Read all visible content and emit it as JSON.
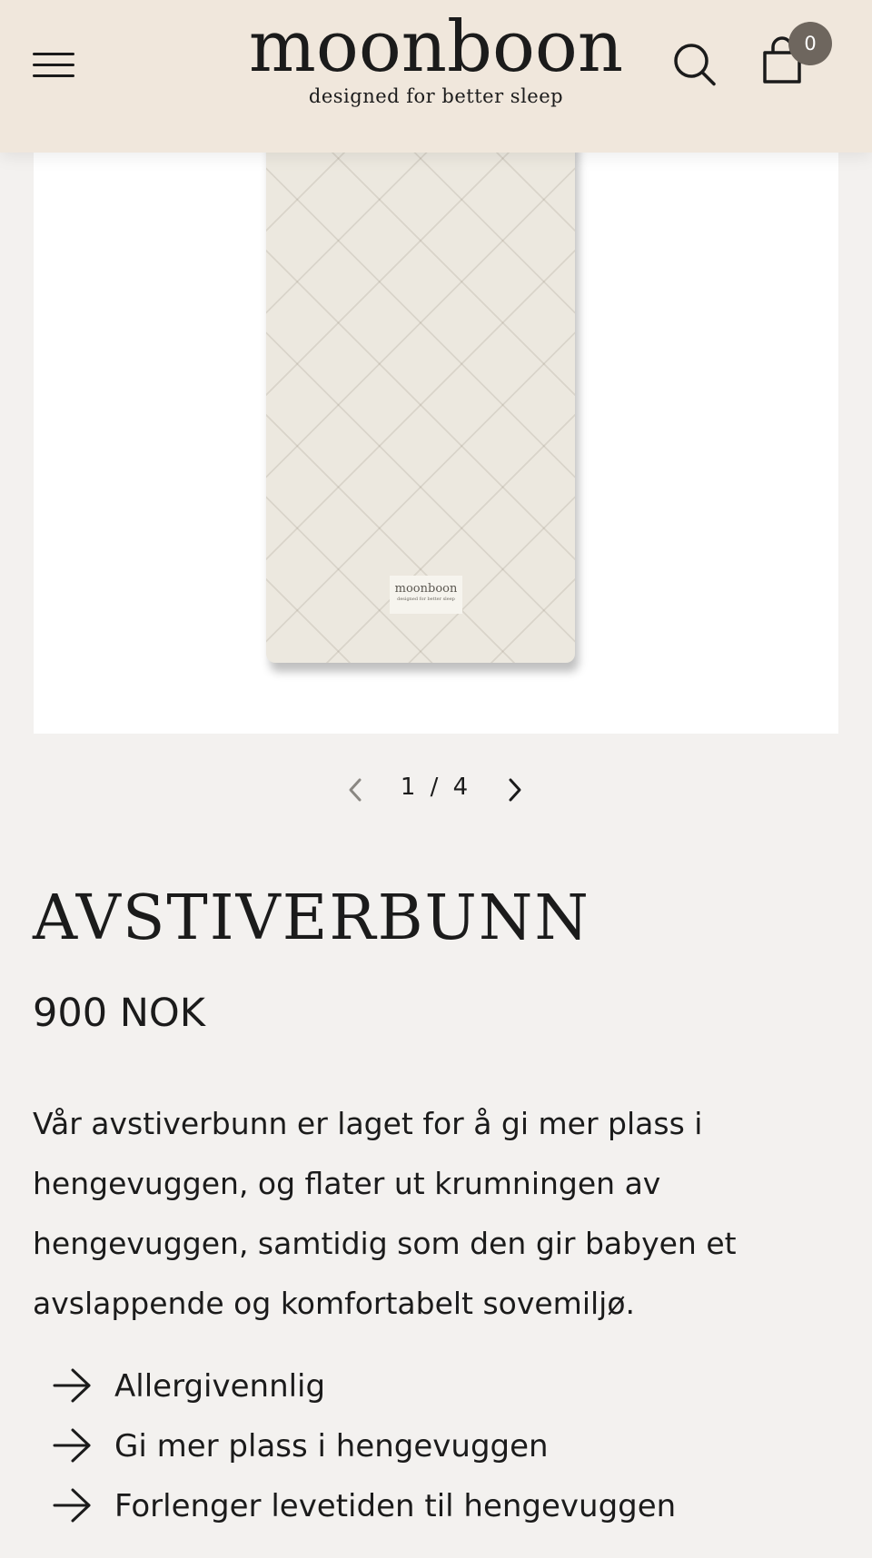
{
  "header": {
    "menu_icon": "hamburger-menu-icon",
    "logo_text": "moonboon",
    "logo_tagline": "designed for better sleep",
    "search_icon": "search-icon",
    "cart_icon": "shopping-bag-icon",
    "cart_count": "0",
    "background_color": "#f0e7dc",
    "badge_color": "#6e665e"
  },
  "gallery": {
    "product_image": "quilted-mattress-product-photo",
    "label_text": "moonboon",
    "label_tagline": "designed for better sleep",
    "current_page": 1,
    "total_pages": 4,
    "pager_text": "1 / 4",
    "prev_icon": "chevron-left-icon",
    "next_icon": "chevron-right-icon"
  },
  "product": {
    "title": "AVSTIVERBUNN",
    "price": "900 NOK",
    "description": "Vår avstiverbunn er laget for å gi mer plass i hengevuggen, og flater ut krumningen av hengevuggen, samtidig som den gir babyen et avslappende og komfortabelt sovemiljø.",
    "features": [
      "Allergivennlig",
      "Gi mer plass i hengevuggen",
      "Forlenger levetiden til hengevuggen"
    ],
    "feature_icon": "arrow-right-icon"
  },
  "colors": {
    "page_background": "#f3f1ef",
    "text": "#1b1b1b"
  }
}
